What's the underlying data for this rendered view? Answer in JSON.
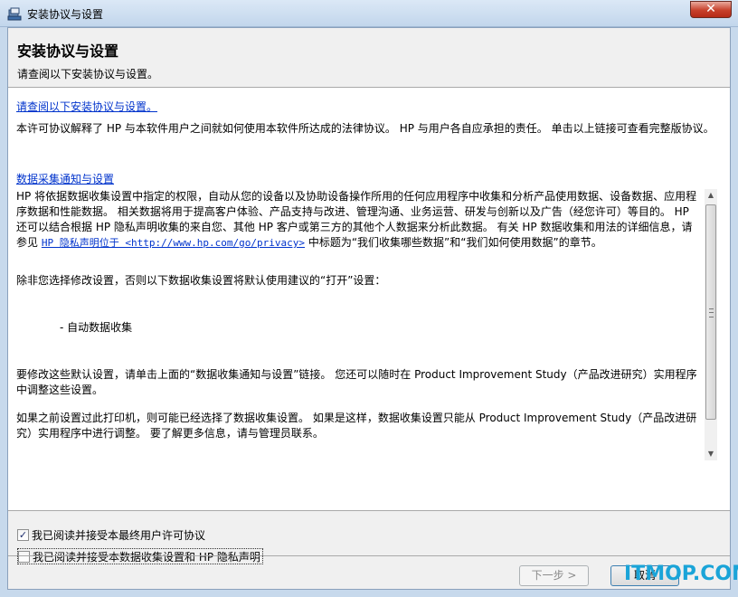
{
  "window": {
    "title": "安装协议与设置",
    "close_glyph": "✕"
  },
  "header": {
    "title": "安装协议与设置",
    "subtitle": "请查阅以下安装协议与设置。"
  },
  "license": {
    "link_text": "请查阅以下安装协议与设置。",
    "description": "本许可协议解释了 HP 与本软件用户之间就如何使用本软件所达成的法律协议。 HP 与用户各自应承担的责任。 单击以上链接可查看完整版协议。"
  },
  "data_collection": {
    "link_text": "数据采集通知与设置",
    "para1": "HP 将依据数据收集设置中指定的权限，自动从您的设备以及协助设备操作所用的任何应用程序中收集和分析产品使用数据、设备数据、应用程序数据和性能数据。 相关数据将用于提高客户体验、产品支持与改进、管理沟通、业务运营、研发与创新以及广告（经您许可）等目的。 HP 还可以结合根据 HP 隐私声明收集的来自您、其他 HP 客户或第三方的其他个人数据来分析此数据。 有关 HP 数据收集和用法的详细信息，请参见",
    "privacy_link": "HP 隐私声明位于 <http://www.hp.com/go/privacy>",
    "para1_tail": "中标题为“我们收集哪些数据”和“我们如何使用数据”的章节。",
    "para2": "除非您选择修改设置，否则以下数据收集设置将默认使用建议的“打开”设置：",
    "bullet": "- 自动数据收集",
    "para3": "要修改这些默认设置，请单击上面的“数据收集通知与设置”链接。 您还可以随时在 Product Improvement Study（产品改进研究）实用程序中调整这些设置。",
    "para4": "如果之前设置过此打印机，则可能已经选择了数据收集设置。 如果是这样，数据收集设置只能从 Product Improvement Study（产品改进研究）实用程序中进行调整。 要了解更多信息，请与管理员联系。"
  },
  "checkboxes": [
    {
      "label": "我已阅读并接受本最终用户许可协议",
      "checked": true,
      "mark": "✓"
    },
    {
      "label": "我已阅读并接受本数据收集设置和 HP 隐私声明",
      "checked": false,
      "mark": ""
    }
  ],
  "buttons": {
    "next": "下一步 >",
    "cancel": "取消"
  },
  "watermark": "ITMOP.COM",
  "colors": {
    "link": "#0033cc",
    "watermark": "#1aa4d8",
    "close": "#c7402b"
  }
}
